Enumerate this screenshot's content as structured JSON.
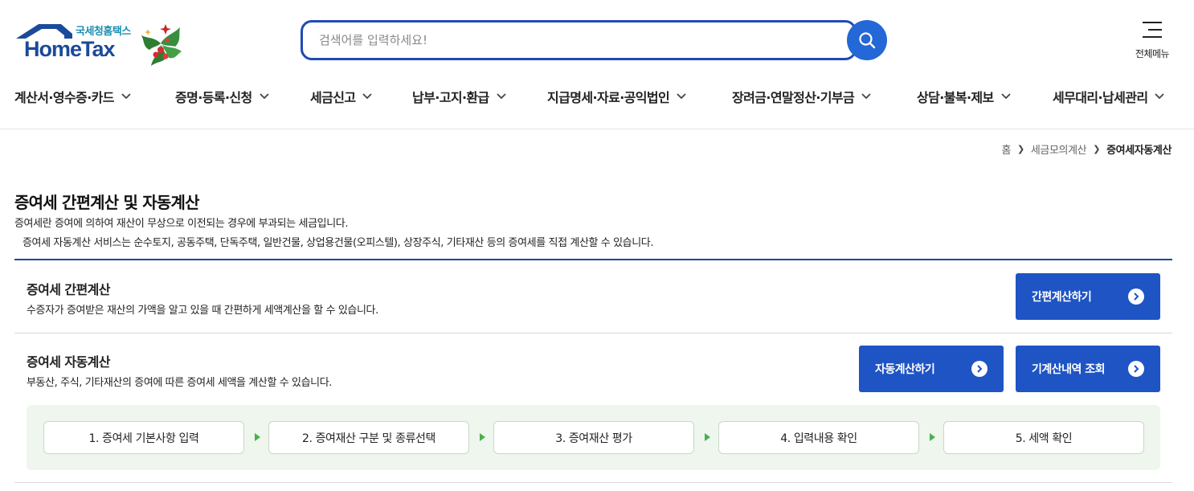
{
  "header": {
    "logo_sub": "국세청홈택스",
    "logo_main": "HomeTax",
    "search_placeholder": "검색어를 입력하세요!",
    "search_value": "",
    "all_menu_label": "전체메뉴"
  },
  "gnb": [
    {
      "label": "계산서·영수증·카드"
    },
    {
      "label": "증명·등록·신청"
    },
    {
      "label": "세금신고"
    },
    {
      "label": "납부·고지·환급"
    },
    {
      "label": "지급명세·자료·공익법인"
    },
    {
      "label": "장려금·연말정산·기부금"
    },
    {
      "label": "상담·불복·제보"
    },
    {
      "label": "세무대리·납세관리"
    }
  ],
  "breadcrumb": {
    "home": "홈",
    "parent": "세금모의계산",
    "current": "증여세자동계산"
  },
  "page": {
    "title": "증여세 간편계산 및 자동계산",
    "desc1": "증여세란 증여에 의하여 재산이 무상으로 이전되는 경우에 부과되는 세금입니다.",
    "desc2": "증여세 자동계산 서비스는 순수토지, 공동주택, 단독주택, 일반건물, 상업용건물(오피스텔), 상장주식, 기타재산 등의 증여세를 직접 계산할 수 있습니다."
  },
  "simple": {
    "title": "증여세 간편계산",
    "desc": "수증자가 증여받은 재산의 가액을 알고 있을 때 간편하게 세액계산을 할 수 있습니다.",
    "button": "간편계산하기"
  },
  "auto": {
    "title": "증여세 자동계산",
    "desc": "부동산, 주식, 기타재산의 증여에 따른 증여세 세액을 계산할 수 있습니다.",
    "button_calc": "자동계산하기",
    "button_history": "기계산내역 조회"
  },
  "steps": [
    "1. 증여세 기본사항 입력",
    "2. 증여재산 구분 및 종류선택",
    "3. 증여재산 평가",
    "4. 입력내용 확인",
    "5. 세액 확인"
  ],
  "colors": {
    "brand_navy": "#1c4a9a",
    "button_blue": "#1f54c4",
    "search_border": "#1f4bb5",
    "steps_bg": "#eef6ee",
    "step_arrow": "#4caf50"
  }
}
